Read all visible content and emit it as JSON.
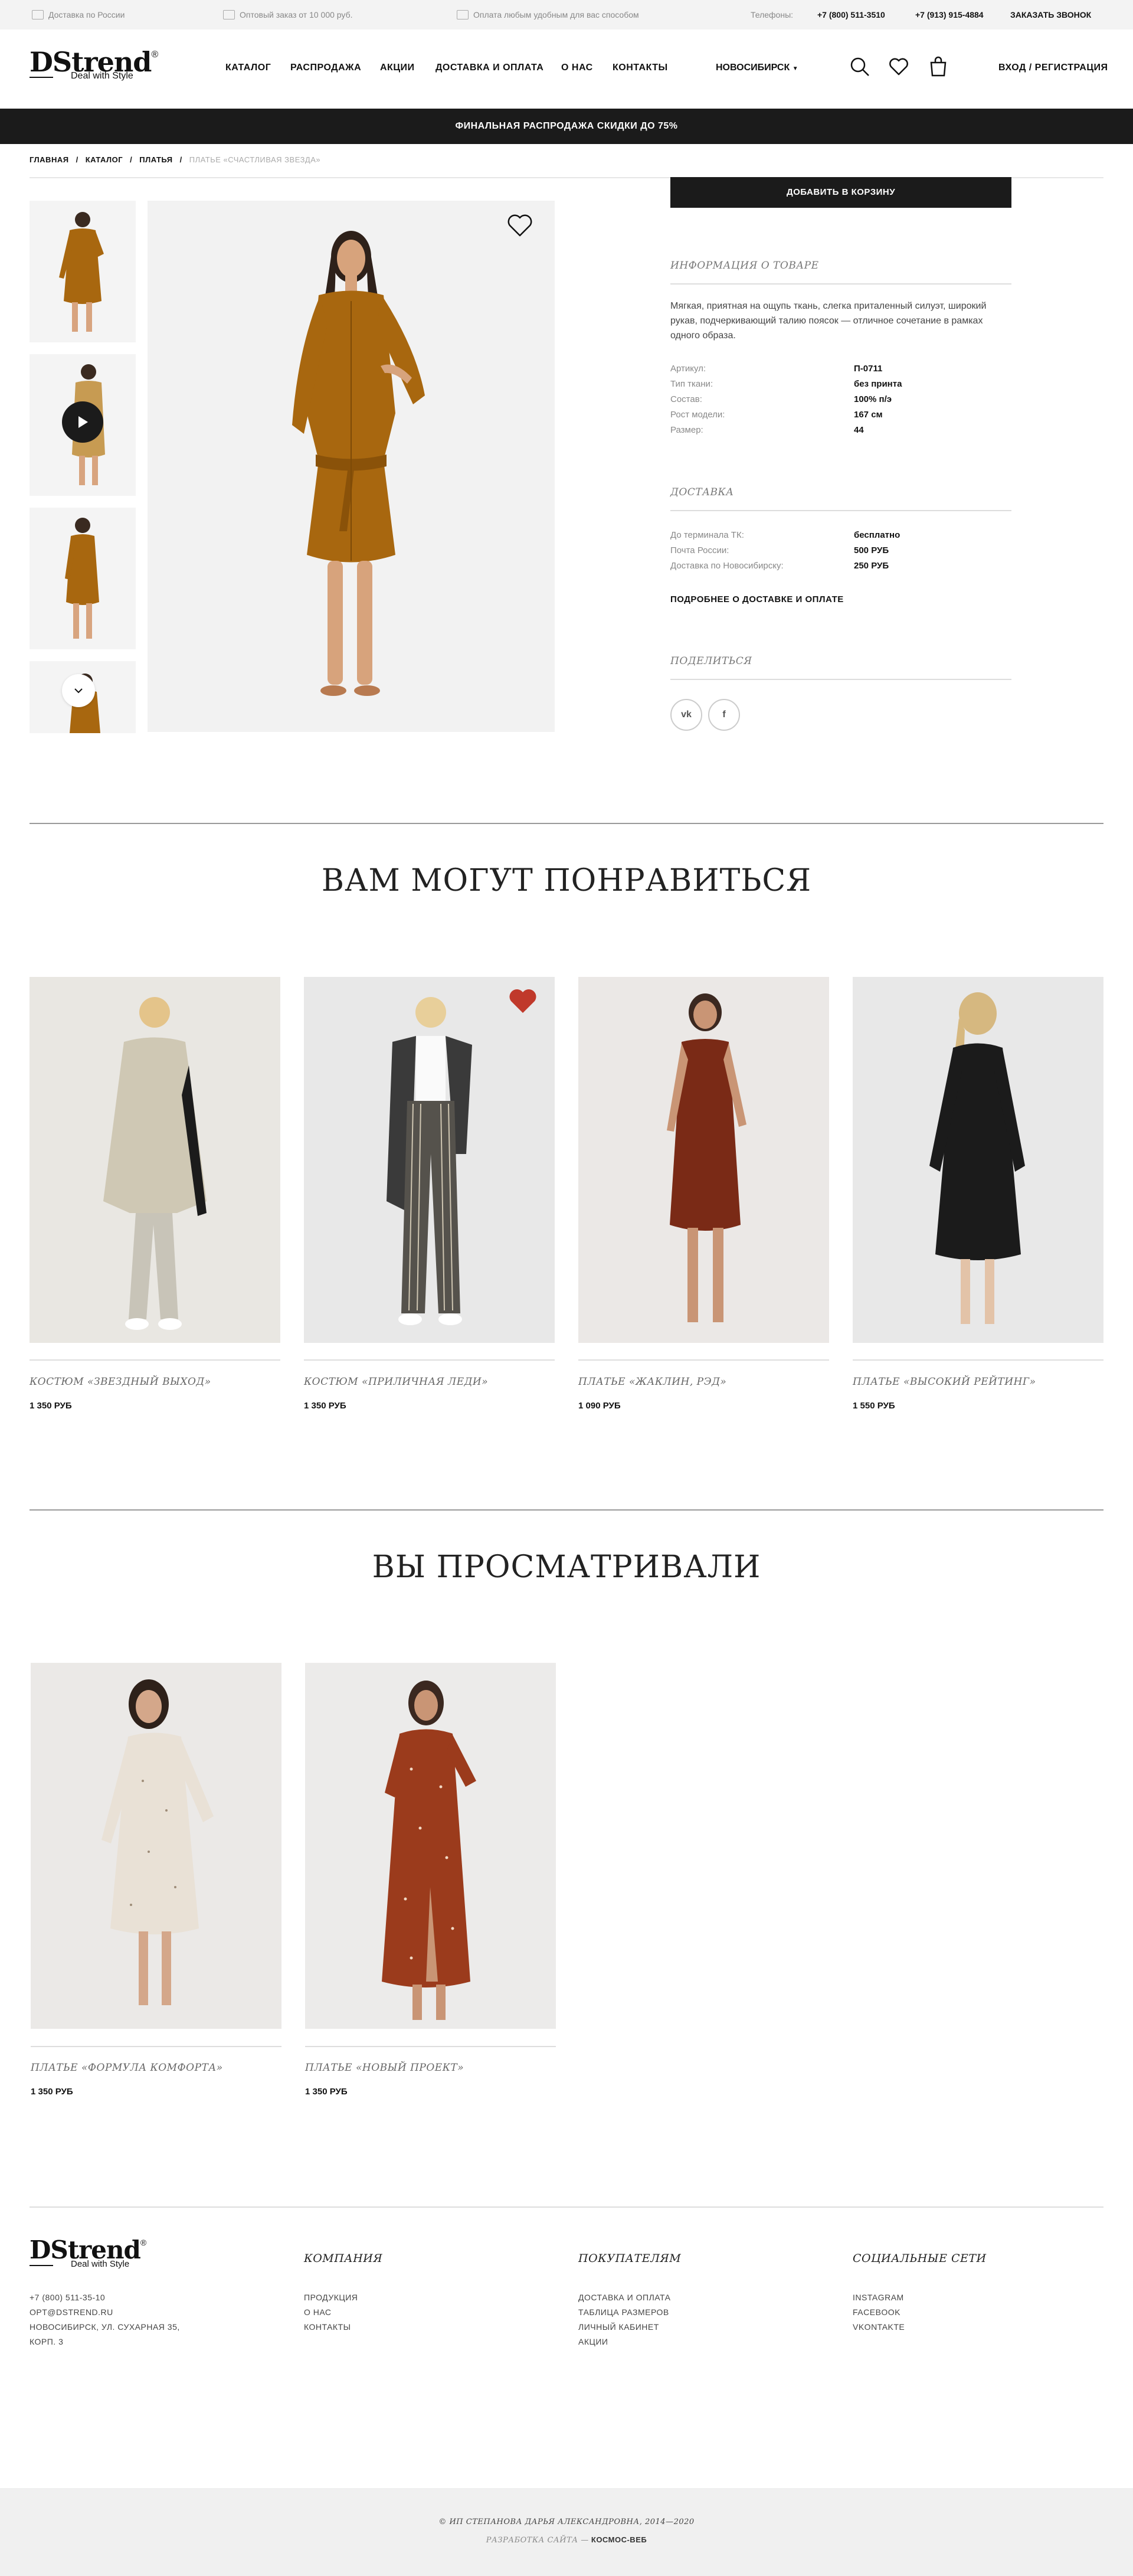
{
  "infobar": {
    "delivery": "Доставка по России",
    "wholesale": "Оптовый заказ от 10 000 руб.",
    "payment": "Оплата любым удобным для вас способом",
    "phones_label": "Телефоны:",
    "phone1": "+7 (800) 511-3510",
    "phone2": "+7 (913) 915-4884",
    "callback": "ЗАКАЗАТЬ ЗВОНОК"
  },
  "header": {
    "logo": "DStrend",
    "logo_reg": "®",
    "tagline": "Deal with Style",
    "nav": [
      "КАТАЛОГ",
      "РАСПРОДАЖА",
      "АКЦИИ",
      "ДОСТАВКА И ОПЛАТА",
      "О НАС",
      "КОНТАКТЫ"
    ],
    "city": "НОВОСИБИРСК",
    "login": "ВХОД / РЕГИСТРАЦИЯ",
    "icons": [
      "search-icon",
      "heart-icon",
      "bag-icon"
    ]
  },
  "promo": "ФИНАЛЬНАЯ РАСПРОДАЖА СКИДКИ ДО 75%",
  "breadcrumbs": [
    "ГЛАВНАЯ",
    "КАТАЛОГ",
    "ПЛАТЬЯ",
    "ПЛАТЬЕ «СЧАСТЛИВАЯ ЗВЕЗДА»"
  ],
  "product": {
    "add_to_cart": "ДОБАВИТЬ В КОРЗИНУ",
    "info_title": "ИНФОРМАЦИЯ О ТОВАРЕ",
    "description": "Мягкая, приятная на ощупь ткань, слегка приталенный силуэт, широкий рукав, подчеркивающий талию поясок — отличное сочетание в рамках одного образа.",
    "specs": [
      {
        "k": "Артикул:",
        "v": "П-0711"
      },
      {
        "k": "Тип ткани:",
        "v": "без принта"
      },
      {
        "k": "Состав:",
        "v": "100% п/э"
      },
      {
        "k": "Рост модели:",
        "v": "167 см"
      },
      {
        "k": "Размер:",
        "v": "44"
      }
    ],
    "delivery_title": "ДОСТАВКА",
    "delivery": [
      {
        "k": "До терминала ТК:",
        "v": "бесплатно"
      },
      {
        "k": "Почта России:",
        "v": "500 РУБ"
      },
      {
        "k": "Доставка по Новосибирску:",
        "v": "250 РУБ"
      }
    ],
    "delivery_more": "ПОДРОБНЕЕ О ДОСТАВКЕ И ОПЛАТЕ",
    "share_title": "ПОДЕЛИТЬСЯ",
    "share": [
      "vk",
      "f"
    ],
    "colors": {
      "dress": "#a8670f",
      "dress_dark": "#8a5209"
    }
  },
  "recommended": {
    "title": "ВАМ МОГУТ ПОНРАВИТЬСЯ",
    "items": [
      {
        "name": "КОСТЮМ «ЗВЕЗДНЫЙ ВЫХОД»",
        "price": "1 350 РУБ"
      },
      {
        "name": "КОСТЮМ «ПРИЛИЧНАЯ ЛЕДИ»",
        "price": "1 350 РУБ"
      },
      {
        "name": "ПЛАТЬЕ «ЖАКЛИН, РЭД»",
        "price": "1 090 РУБ"
      },
      {
        "name": "ПЛАТЬЕ «ВЫСОКИЙ РЕЙТИНГ»",
        "price": "1 550 РУБ"
      }
    ]
  },
  "viewed": {
    "title": "ВЫ ПРОСМАТРИВАЛИ",
    "items": [
      {
        "name": "ПЛАТЬЕ «ФОРМУЛА КОМФОРТА»",
        "price": "1 350 РУБ"
      },
      {
        "name": "ПЛАТЬЕ «НОВЫЙ ПРОЕКТ»",
        "price": "1 350 РУБ"
      }
    ]
  },
  "footer": {
    "contacts": [
      "+7 (800) 511-35-10",
      "OPT@DSTREND.RU",
      "НОВОСИБИРСК, УЛ. СУХАРНАЯ 35,",
      "КОРП. 3"
    ],
    "company_title": "КОМПАНИЯ",
    "company": [
      "ПРОДУКЦИЯ",
      "О НАС",
      "КОНТАКТЫ"
    ],
    "buyers_title": "ПОКУПАТЕЛЯМ",
    "buyers": [
      "ДОСТАВКА И ОПЛАТА",
      "ТАБЛИЦА РАЗМЕРОВ",
      "ЛИЧНЫЙ КАБИНЕТ",
      "АКЦИИ"
    ],
    "social_title": "СОЦИАЛЬНЫЕ СЕТИ",
    "social": [
      "INSTAGRAM",
      "FACEBOOK",
      "VKONTAKTE"
    ],
    "copyright": "© ИП СТЕПАНОВА ДАРЬЯ АЛЕКСАНДРОВНА, 2014—2020",
    "dev_prefix": "РАЗРАБОТКА САЙТА —",
    "dev": "КОСМОС-ВЕБ"
  }
}
